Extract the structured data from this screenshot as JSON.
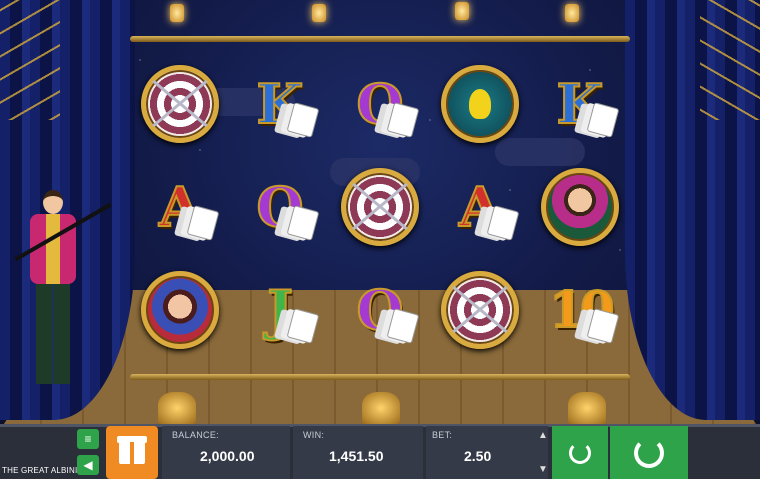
{
  "game": {
    "name": "THE GREAT ALBINI"
  },
  "reels": {
    "rows": [
      [
        {
          "symbol": "target",
          "label": ""
        },
        {
          "symbol": "letter",
          "label": "K",
          "cls": "c-K"
        },
        {
          "symbol": "letter",
          "label": "Q",
          "cls": "c-Q"
        },
        {
          "symbol": "canary",
          "label": ""
        },
        {
          "symbol": "letter",
          "label": "K",
          "cls": "c-K"
        }
      ],
      [
        {
          "symbol": "letter",
          "label": "A",
          "cls": "c-A"
        },
        {
          "symbol": "letter",
          "label": "Q",
          "cls": "c-Q"
        },
        {
          "symbol": "target",
          "label": ""
        },
        {
          "symbol": "letter",
          "label": "A",
          "cls": "c-A"
        },
        {
          "symbol": "portrait-m",
          "label": ""
        }
      ],
      [
        {
          "symbol": "portrait-f",
          "label": ""
        },
        {
          "symbol": "letter",
          "label": "J",
          "cls": "c-J"
        },
        {
          "symbol": "letter",
          "label": "Q",
          "cls": "c-Q"
        },
        {
          "symbol": "target",
          "label": ""
        },
        {
          "symbol": "letter",
          "label": "10",
          "cls": "c-10"
        }
      ]
    ]
  },
  "hud": {
    "balance_label": "BALANCE:",
    "balance_value": "2,000.00",
    "win_label": "WIN:",
    "win_value": "1,451.50",
    "bet_label": "BET:",
    "bet_value": "2.50",
    "bet_up": "▲",
    "bet_down": "▼",
    "menu_icon": "≡",
    "sound_icon": "◀"
  },
  "colors": {
    "accent_green": "#2fa34a",
    "gift_orange": "#f08a22",
    "hud_bg": "#2a2f3a"
  }
}
